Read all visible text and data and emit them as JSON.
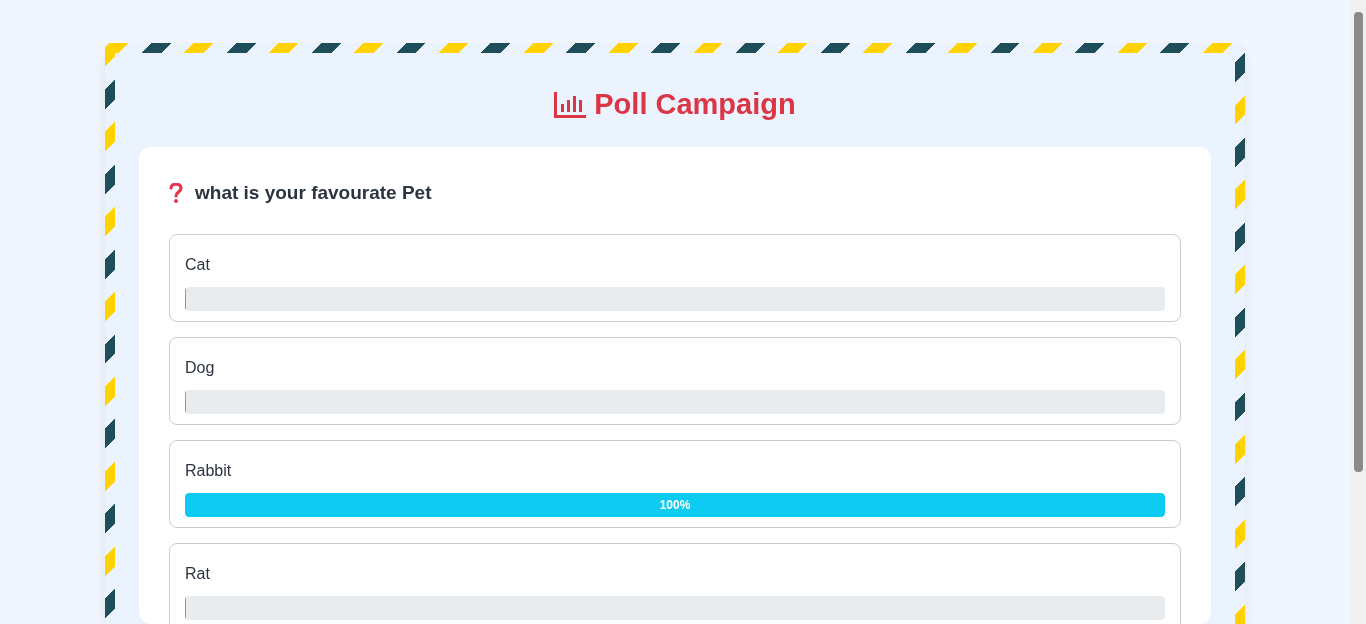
{
  "title": "Poll Campaign",
  "question": "what is your favourate Pet",
  "options": [
    {
      "label": "Cat",
      "level": 0
    },
    {
      "label": "Dog",
      "level": 0
    },
    {
      "label": "Rabbit",
      "level": 1,
      "reading": "100%"
    },
    {
      "label": "Rat",
      "level": 0
    }
  ]
}
